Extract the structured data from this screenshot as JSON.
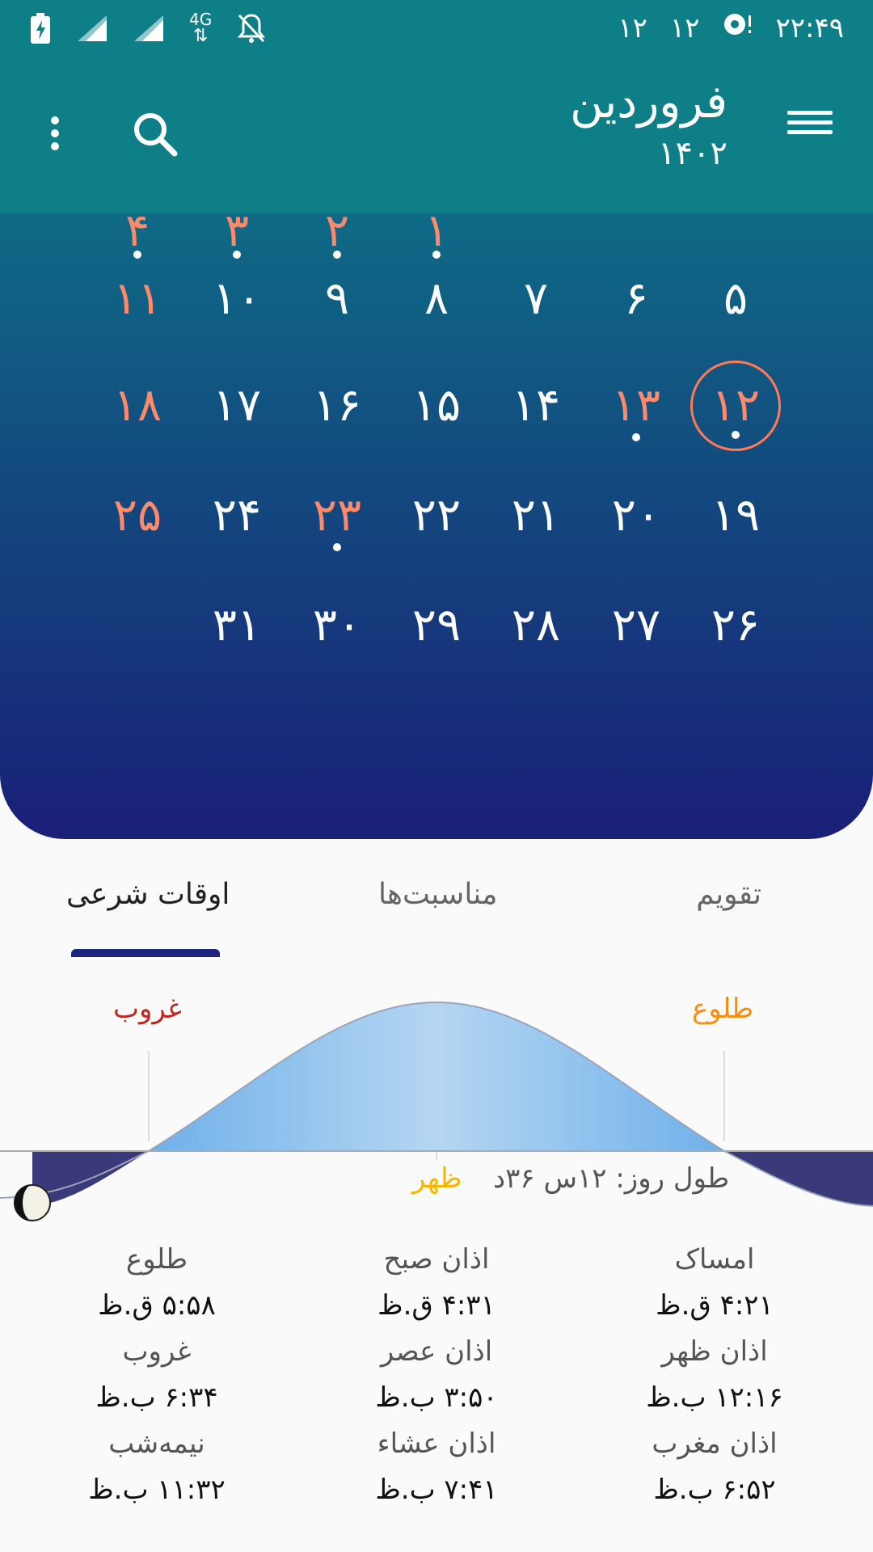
{
  "status_bar": {
    "time": "۲۲:۴۹",
    "network": "4G",
    "sim1": "۱۲",
    "sim2": "۱۲"
  },
  "app_bar": {
    "month": "فروردین",
    "year": "۱۴۰۲",
    "icons": [
      "menu-icon",
      "search-icon",
      "more-vert-icon"
    ]
  },
  "calendar": {
    "partial_top_row": [
      {
        "day": "۴",
        "holiday": true
      },
      {
        "day": "۳",
        "holiday": true
      },
      {
        "day": "۲",
        "holiday": true
      },
      {
        "day": "۱",
        "holiday": true
      }
    ],
    "rows": [
      [
        {
          "day": "۱۱",
          "holiday": true
        },
        {
          "day": "۱۰"
        },
        {
          "day": "۹"
        },
        {
          "day": "۸"
        },
        {
          "day": "۷"
        },
        {
          "day": "۶"
        },
        {
          "day": "۵"
        }
      ],
      [
        {
          "day": "۱۸",
          "holiday": true
        },
        {
          "day": "۱۷"
        },
        {
          "day": "۱۶"
        },
        {
          "day": "۱۵"
        },
        {
          "day": "۱۴"
        },
        {
          "day": "۱۳",
          "holiday": true,
          "event": true
        },
        {
          "day": "۱۲",
          "holiday": true,
          "event": true,
          "today": true
        }
      ],
      [
        {
          "day": "۲۵",
          "holiday": true
        },
        {
          "day": "۲۴"
        },
        {
          "day": "۲۳",
          "holiday": true,
          "event": true
        },
        {
          "day": "۲۲"
        },
        {
          "day": "۲۱"
        },
        {
          "day": "۲۰"
        },
        {
          "day": "۱۹"
        }
      ],
      [
        {
          "day": ""
        },
        {
          "day": "۳۱"
        },
        {
          "day": "۳۰"
        },
        {
          "day": "۲۹"
        },
        {
          "day": "۲۸"
        },
        {
          "day": "۲۷"
        },
        {
          "day": "۲۶"
        }
      ]
    ],
    "colors": {
      "holiday": "#ff8a6a",
      "today_ring": "#ff7a55"
    }
  },
  "tabs": [
    {
      "label": "تقویم"
    },
    {
      "label": "مناسبت‌ها"
    },
    {
      "label": "اوقات شرعی",
      "active": true
    }
  ],
  "sun_chart": {
    "sunrise_label": "طلوع",
    "sunset_label": "غروب",
    "noon_label": "ظهر",
    "day_length": "طول روز: ۱۲س ۳۶د",
    "colors": {
      "sunrise": "#f39012",
      "sunset": "#c0281f",
      "noon": "#f5b700",
      "day_fill": "#7ab8ec",
      "night_fill": "#3a3a7a"
    }
  },
  "prayer_times": [
    {
      "name": "امساک",
      "value": "۴:۲۱ ق.ظ"
    },
    {
      "name": "اذان صبح",
      "value": "۴:۳۱ ق.ظ"
    },
    {
      "name": "طلوع",
      "value": "۵:۵۸ ق.ظ"
    },
    {
      "name": "اذان ظهر",
      "value": "۱۲:۱۶ ب.ظ"
    },
    {
      "name": "اذان عصر",
      "value": "۳:۵۰ ب.ظ"
    },
    {
      "name": "غروب",
      "value": "۶:۳۴ ب.ظ"
    },
    {
      "name": "اذان مغرب",
      "value": "۶:۵۲ ب.ظ"
    },
    {
      "name": "اذان عشاء",
      "value": "۷:۴۱ ب.ظ"
    },
    {
      "name": "نیمه‌شب",
      "value": "۱۱:۳۲ ب.ظ"
    }
  ]
}
